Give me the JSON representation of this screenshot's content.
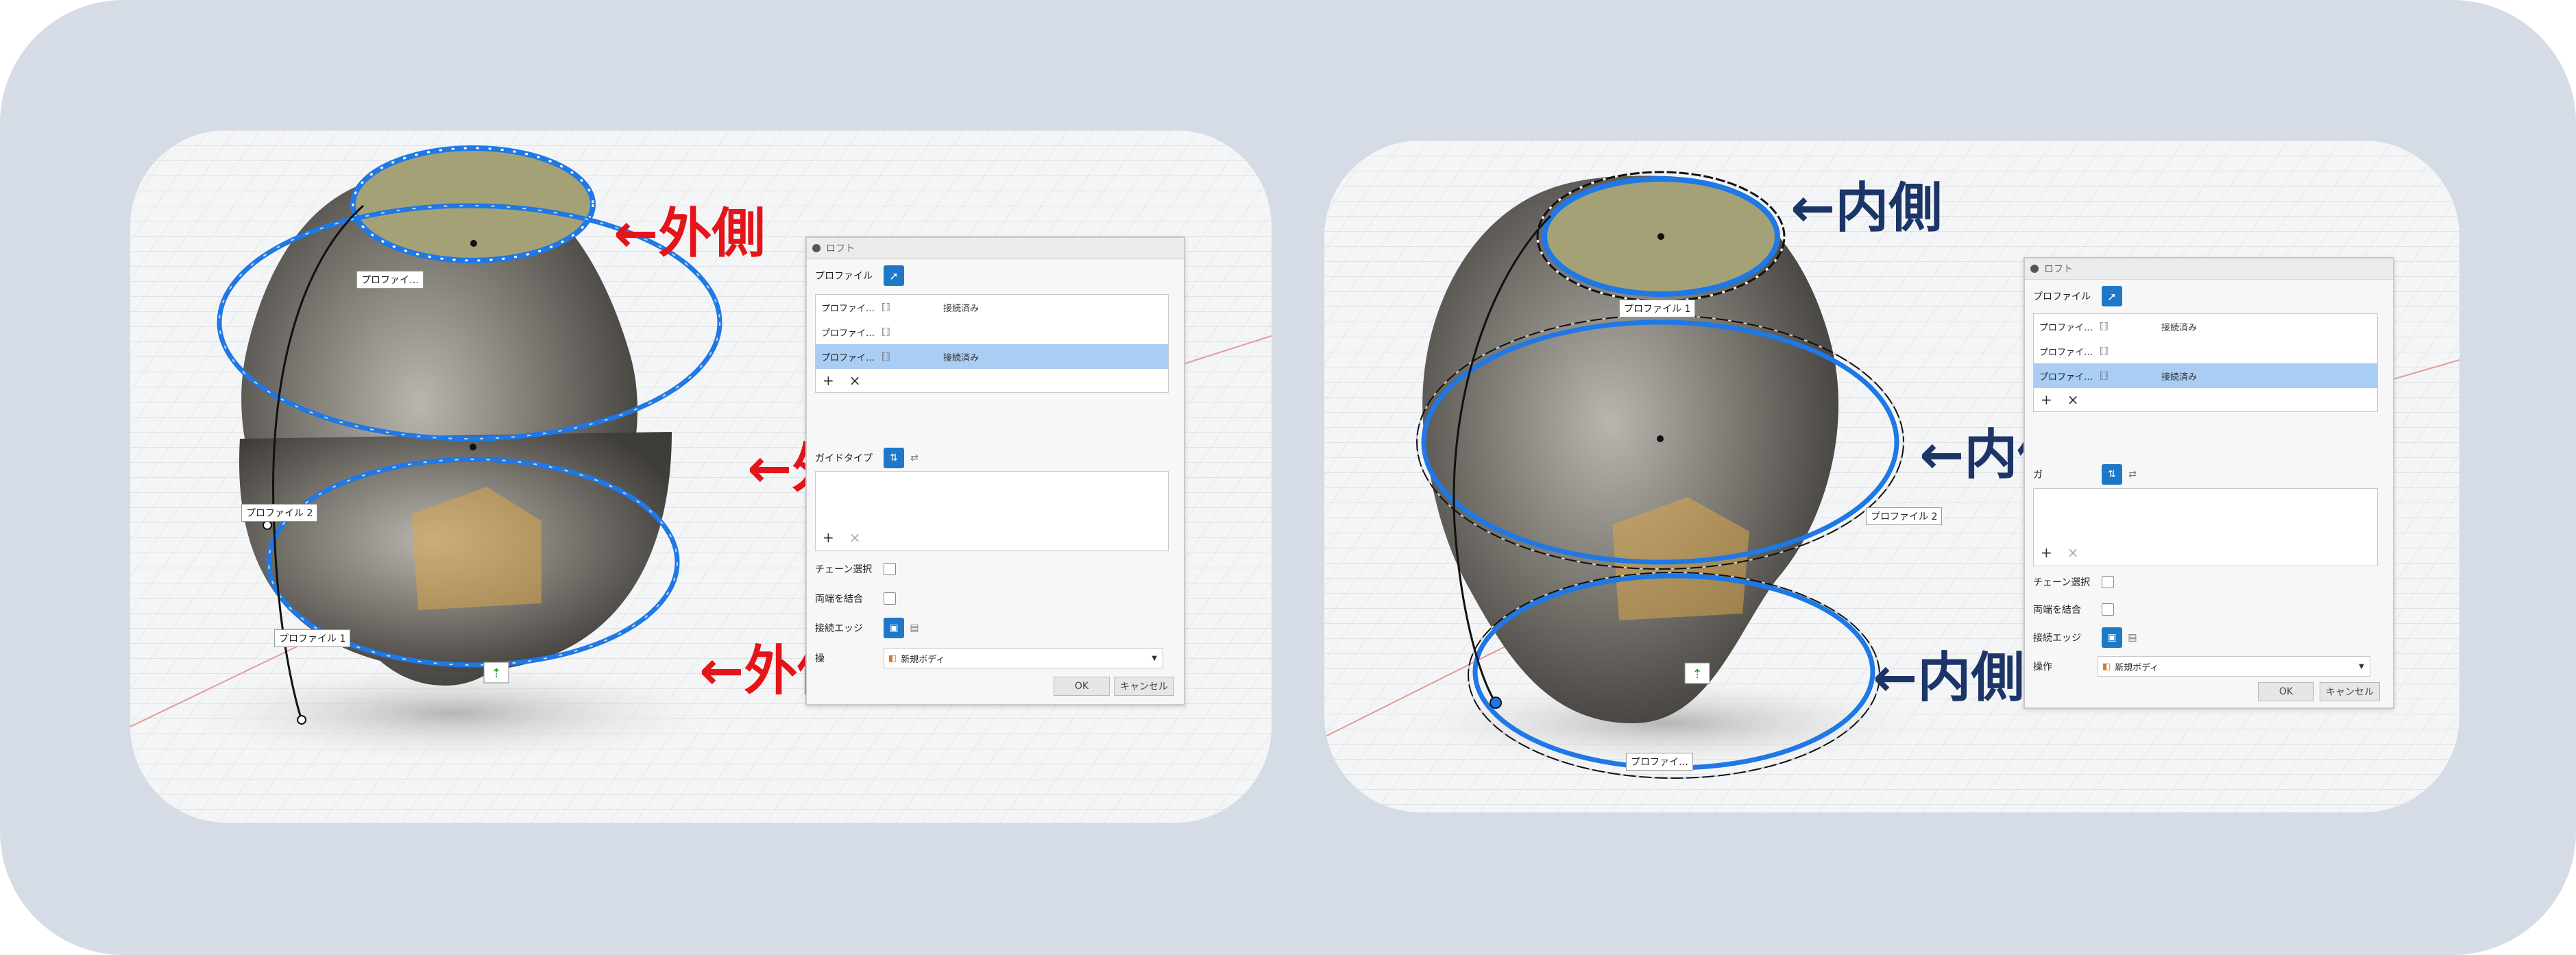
{
  "left_view": {
    "callouts": [
      "←外側",
      "←外側",
      "←外側"
    ],
    "tags": [
      "プロファイ…",
      "プロファイル 2",
      "プロファイル 1"
    ],
    "dialog": {
      "title": "ロフト",
      "profile_label": "プロファイル",
      "rows": [
        {
          "name": "プロファイ…",
          "status": "接続済み"
        },
        {
          "name": "プロファイ…",
          "status": ""
        },
        {
          "name": "プロファイ…",
          "status": "接続済み"
        }
      ],
      "guide_type_label": "ガイドタイプ",
      "chain_select_label": "チェーン選択",
      "merge_ends_label": "両端を結合",
      "tangent_edges_label": "接続エッジ",
      "operation_label": "操",
      "operation_value": "新規ボディ",
      "ok_label": "OK",
      "cancel_label": "キャンセル"
    }
  },
  "right_view": {
    "callouts": [
      "←内側",
      "←内側",
      "←内側"
    ],
    "tags": [
      "プロファイル 1",
      "プロファイル 2",
      "プロファイ…"
    ],
    "dialog": {
      "title": "ロフト",
      "profile_label": "プロファイル",
      "rows": [
        {
          "name": "プロファイ…",
          "status": "接続済み"
        },
        {
          "name": "プロファイ…",
          "status": ""
        },
        {
          "name": "プロファイ…",
          "status": "接続済み"
        }
      ],
      "guide_type_label": "ガ",
      "chain_select_label": "チェーン選択",
      "merge_ends_label": "両端を結合",
      "tangent_edges_label": "接続エッジ",
      "operation_label": "操作",
      "operation_value": "新規ボディ",
      "ok_label": "OK",
      "cancel_label": "キャンセル"
    }
  },
  "colors": {
    "outer_frame": "#d5dce6",
    "profile_highlight": "#1e78e6",
    "callout_outer": "#e3151a",
    "callout_inner": "#1c3568",
    "selected_row": "#a9cdf3"
  }
}
